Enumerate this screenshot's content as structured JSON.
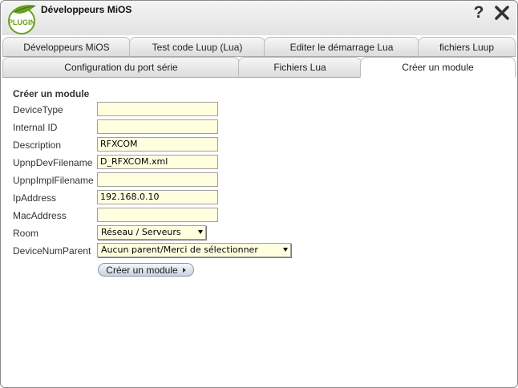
{
  "window": {
    "title": "Développeurs MiOS",
    "logo_text": "PLUGIN",
    "help_label": "?"
  },
  "tabs_row1": [
    {
      "label": "Développeurs MiOS"
    },
    {
      "label": "Test code Luup (Lua)"
    },
    {
      "label": "Editer le démarrage Lua"
    },
    {
      "label": "fichiers Luup"
    }
  ],
  "tabs_row2": [
    {
      "label": "Configuration du port série"
    },
    {
      "label": "Fichiers Lua"
    },
    {
      "label": "Créer un module",
      "active": true
    }
  ],
  "form": {
    "section_title": "Créer un module",
    "fields": [
      {
        "label": "DeviceType",
        "value": ""
      },
      {
        "label": "Internal ID",
        "value": ""
      },
      {
        "label": "Description",
        "value": "RFXCOM"
      },
      {
        "label": "UpnpDevFilename",
        "value": "D_RFXCOM.xml"
      },
      {
        "label": "UpnpImplFilename",
        "value": ""
      },
      {
        "label": "IpAddress",
        "value": "192.168.0.10"
      },
      {
        "label": "MacAddress",
        "value": ""
      }
    ],
    "room": {
      "label": "Room",
      "selected": "Réseau / Serveurs"
    },
    "parent": {
      "label": "DeviceNumParent",
      "selected": "Aucun parent/Merci de sélectionner"
    },
    "submit_label": "Créer un module"
  },
  "colors": {
    "input_bg": "#ffffe0",
    "logo_green": "#6aa121",
    "button_gradient_bottom": "#c9d3e0"
  }
}
